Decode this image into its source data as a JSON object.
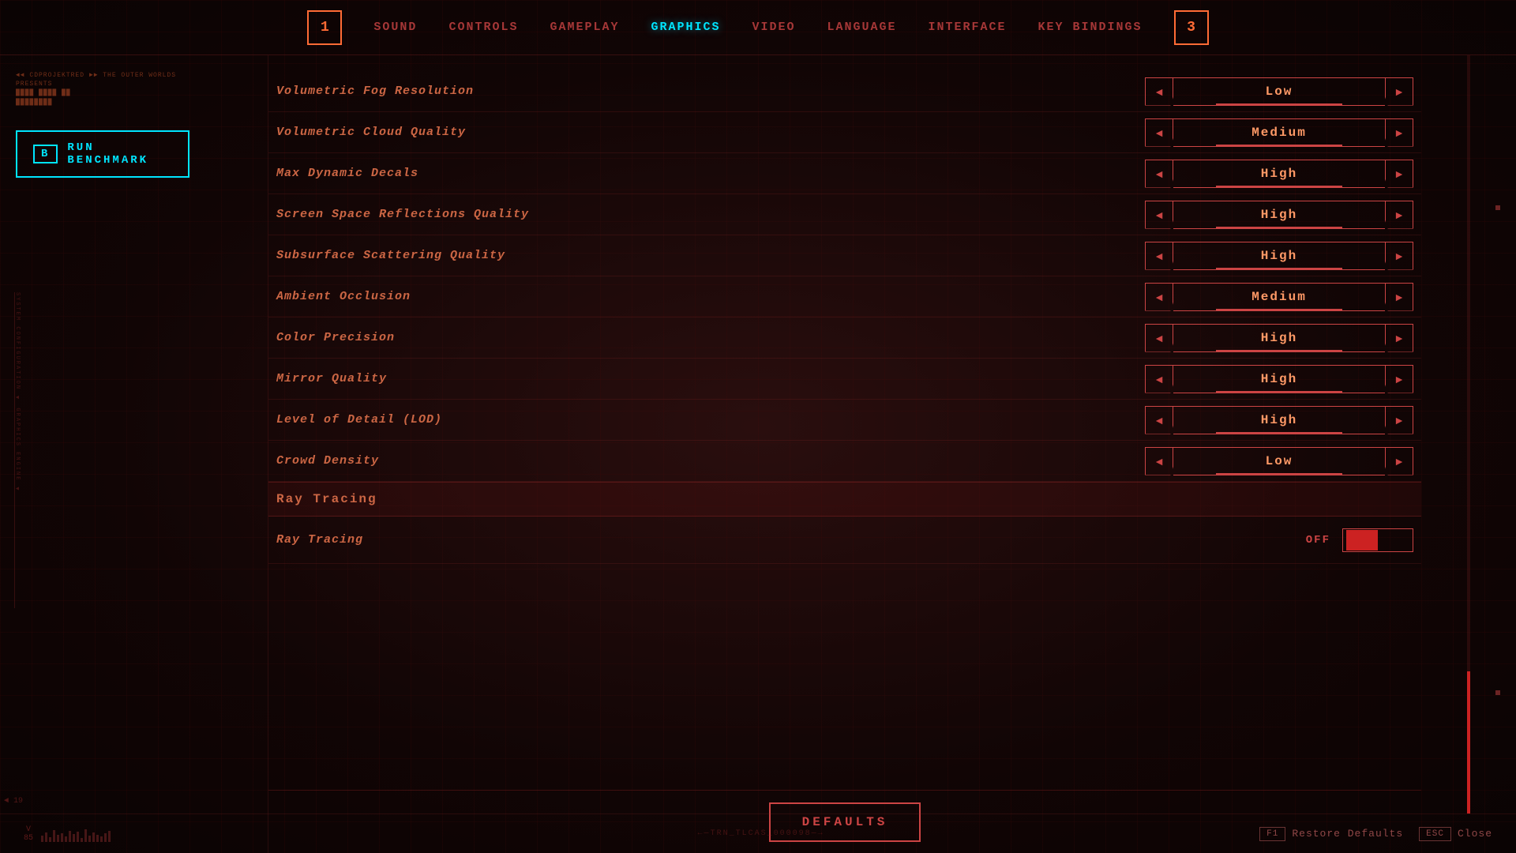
{
  "nav": {
    "left_bracket": "1",
    "right_bracket": "3",
    "items": [
      {
        "id": "sound",
        "label": "SOUND",
        "active": false
      },
      {
        "id": "controls",
        "label": "CONTROLS",
        "active": false
      },
      {
        "id": "gameplay",
        "label": "GAMEPLAY",
        "active": false
      },
      {
        "id": "graphics",
        "label": "GRAPHICS",
        "active": true
      },
      {
        "id": "video",
        "label": "VIDEO",
        "active": false
      },
      {
        "id": "language",
        "label": "LANGUAGE",
        "active": false
      },
      {
        "id": "interface",
        "label": "INTERFACE",
        "active": false
      },
      {
        "id": "key_bindings",
        "label": "KEY BINDINGS",
        "active": false
      }
    ]
  },
  "sidebar": {
    "benchmark_key": "B",
    "benchmark_label": "RUN BENCHMARK"
  },
  "settings": [
    {
      "id": "volumetric-fog",
      "label": "Volumetric Fog Resolution",
      "value": "Low"
    },
    {
      "id": "volumetric-cloud",
      "label": "Volumetric Cloud Quality",
      "value": "Medium"
    },
    {
      "id": "max-dynamic-decals",
      "label": "Max Dynamic Decals",
      "value": "High"
    },
    {
      "id": "screen-space-reflections",
      "label": "Screen Space Reflections Quality",
      "value": "High"
    },
    {
      "id": "subsurface-scattering",
      "label": "Subsurface Scattering Quality",
      "value": "High"
    },
    {
      "id": "ambient-occlusion",
      "label": "Ambient Occlusion",
      "value": "Medium"
    },
    {
      "id": "color-precision",
      "label": "Color Precision",
      "value": "High"
    },
    {
      "id": "mirror-quality",
      "label": "Mirror Quality",
      "value": "High"
    },
    {
      "id": "level-of-detail",
      "label": "Level of Detail (LOD)",
      "value": "High"
    },
    {
      "id": "crowd-density",
      "label": "Crowd Density",
      "value": "Low"
    }
  ],
  "ray_tracing_section": {
    "header": "Ray Tracing",
    "label": "Ray Tracing",
    "state": "OFF"
  },
  "footer": {
    "defaults_label": "DEFAULTS",
    "version_v": "V",
    "version_num": "85",
    "center_text": "TRN_TLCAS_000098",
    "restore_key": "F1",
    "restore_label": "Restore Defaults",
    "close_key": "ESC",
    "close_label": "Close"
  }
}
